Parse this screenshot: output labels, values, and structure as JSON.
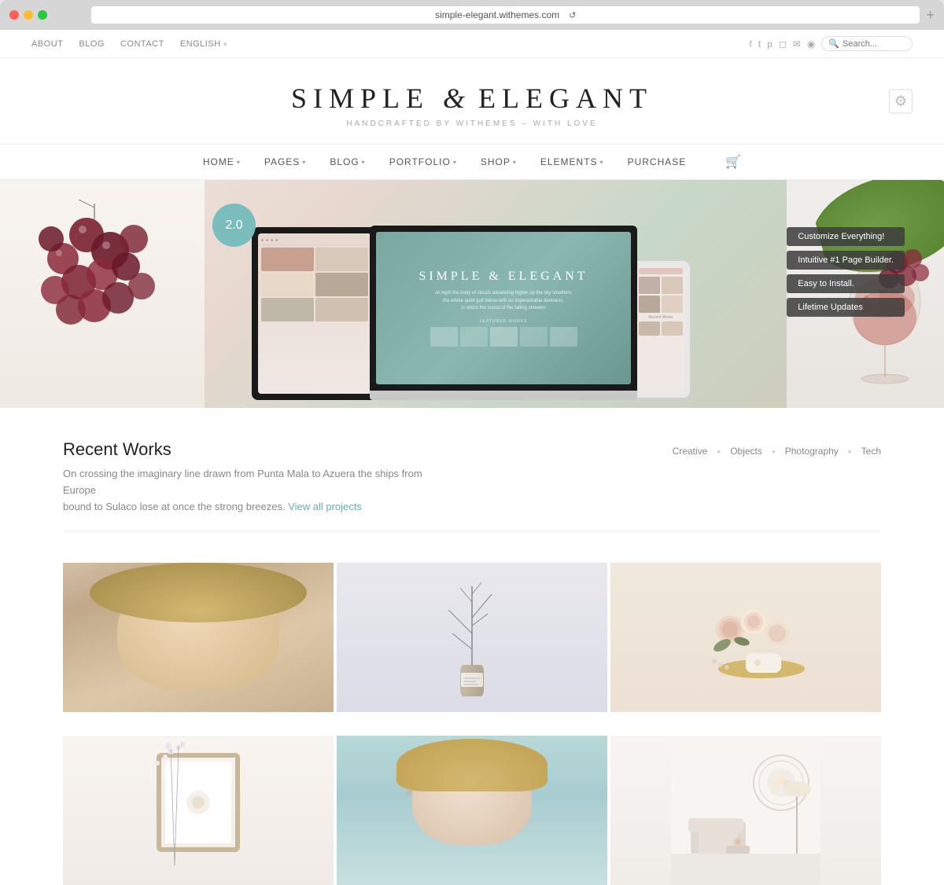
{
  "browser": {
    "url": "simple-elegant.withemes.com",
    "tab_label": "simple-elegant.withemes.com"
  },
  "topbar": {
    "nav": {
      "about": "ABOUT",
      "blog": "BLOG",
      "contact": "CONTACT",
      "language": "ENGLISH"
    },
    "search_placeholder": "Search..."
  },
  "site": {
    "title_part1": "SIMPLE",
    "ampersand": "&",
    "title_part2": "ELEGANT",
    "tagline": "HANDCRAFTED BY WITHEMES – WITH LOVE"
  },
  "main_nav": {
    "items": [
      {
        "label": "HOME",
        "has_dropdown": true
      },
      {
        "label": "PAGES",
        "has_dropdown": true
      },
      {
        "label": "BLOG",
        "has_dropdown": true
      },
      {
        "label": "PORTFOLIO",
        "has_dropdown": true
      },
      {
        "label": "SHOP",
        "has_dropdown": true
      },
      {
        "label": "ELEMENTS",
        "has_dropdown": true
      },
      {
        "label": "PURCHASE",
        "has_dropdown": false
      }
    ]
  },
  "hero": {
    "version_badge": "2.0",
    "feature_tags": [
      "Customize Everything!",
      "Intuitive #1 Page Builder.",
      "Easy to Install.",
      "Lifetime Updates"
    ],
    "laptop_title": "SIMPLE & ELEGANT",
    "laptop_body": "At night the body of clouds advancing higher up the sky smothers\nthe whole quiet gulf below with an impenetrable darkness,\nin which the sound of the falling showers"
  },
  "recent_works": {
    "section_title": "Recent Works",
    "description": "On crossing the imaginary line drawn from Punta Mala to Azuera the ships from Europe\nbound to Sulaco lose at once the strong breezes.",
    "view_all_link": "View all projects",
    "filters": [
      "Creative",
      "Objects",
      "Photography",
      "Tech"
    ]
  },
  "portfolio": {
    "items": [
      {
        "id": 1,
        "type": "portrait_woman_blonde"
      },
      {
        "id": 2,
        "type": "plant_vase"
      },
      {
        "id": 3,
        "type": "flowers_arrangement"
      },
      {
        "id": 4,
        "type": "frame_flowers"
      },
      {
        "id": 5,
        "type": "portrait_woman_blonde_short"
      },
      {
        "id": 6,
        "type": "room_decor"
      }
    ]
  },
  "social": {
    "icons": [
      "facebook",
      "twitter",
      "pinterest",
      "instagram",
      "email",
      "rss"
    ]
  }
}
